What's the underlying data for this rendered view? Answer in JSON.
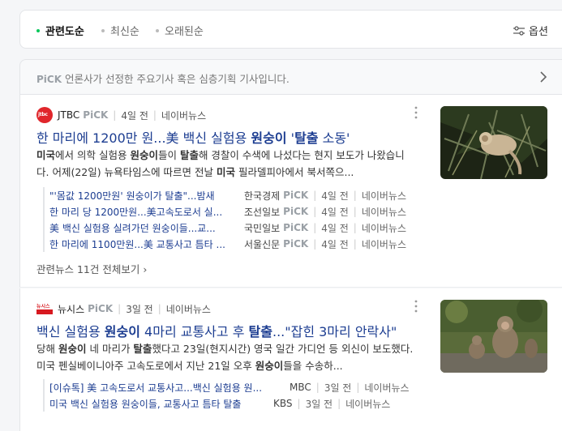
{
  "sort": {
    "items": [
      {
        "label": "관련도순",
        "active": true
      },
      {
        "label": "최신순",
        "active": false
      },
      {
        "label": "오래된순",
        "active": false
      }
    ],
    "options_label": "옵션"
  },
  "pick_notice": {
    "logo": "PiCK",
    "text": "언론사가 선정한 주요기사 혹은 심층기획 기사입니다."
  },
  "articles": [
    {
      "press": "JTBC",
      "pick": "PiCK",
      "time": "4일 전",
      "source": "네이버뉴스",
      "logo_text": "jtbc",
      "title_parts": [
        "한 마리에 1200만 원...美 백신 실험용 ",
        "원숭이",
        " '",
        "탈출",
        " 소동'"
      ],
      "desc_parts": [
        "미국",
        "에서 의학 실험용 ",
        "원숭이",
        "들이 ",
        "탈출",
        "해 경찰이 수색에 나섰다는 현지 보도가 나왔습니다. 어제(22일) 뉴욕타임스에 따르면 전날 ",
        "미국",
        " 필라델피아에서 북서쪽으..."
      ],
      "related": [
        {
          "title": "\"'몸값 1200만원' 원숭이가 탈출\"...밤새 ",
          "press": "한국경제",
          "pick": "PiCK",
          "time": "4일 전",
          "source": "네이버뉴스"
        },
        {
          "title": "한 마리 당 1200만원...美고속도로서 실...",
          "press": "조선일보",
          "pick": "PiCK",
          "time": "4일 전",
          "source": "네이버뉴스"
        },
        {
          "title": "美 백신 실험용 실려가던 원숭이들...교...",
          "press": "국민일보",
          "pick": "PiCK",
          "time": "4일 전",
          "source": "네이버뉴스"
        },
        {
          "title": "한 마리에 1100만원...美 교통사고 틈타 ...",
          "press": "서울신문",
          "pick": "PiCK",
          "time": "4일 전",
          "source": "네이버뉴스"
        }
      ],
      "all_news": "관련뉴스 11건 전체보기"
    },
    {
      "press": "뉴시스",
      "pick": "PiCK",
      "time": "3일 전",
      "source": "네이버뉴스",
      "logo_text": "뉴시스",
      "title_parts": [
        "백신 실험용 ",
        "원숭이",
        " 4마리 교통사고 후 ",
        "탈출",
        "...\"잡힌 3마리 안락사\""
      ],
      "desc_parts": [
        "당해 ",
        "원숭이",
        " 네 마리가 ",
        "탈출",
        "했다고 23일(현지시간) 영국 일간 가디언 등 외신이 보도했다. 미국 펜실베이니아주 고속도로에서 지난 21일 오후 ",
        "원숭이",
        "들을 수송하..."
      ],
      "related": [
        {
          "title": "[이슈톡] 美 고속도로서 교통사고...백신 실험용 원...",
          "press": "MBC",
          "time": "3일 전",
          "source": "네이버뉴스"
        },
        {
          "title": "미국 백신 실험용 원숭이들, 교통사고 틈타 탈출",
          "press": "KBS",
          "time": "3일 전",
          "source": "네이버뉴스"
        }
      ]
    }
  ]
}
